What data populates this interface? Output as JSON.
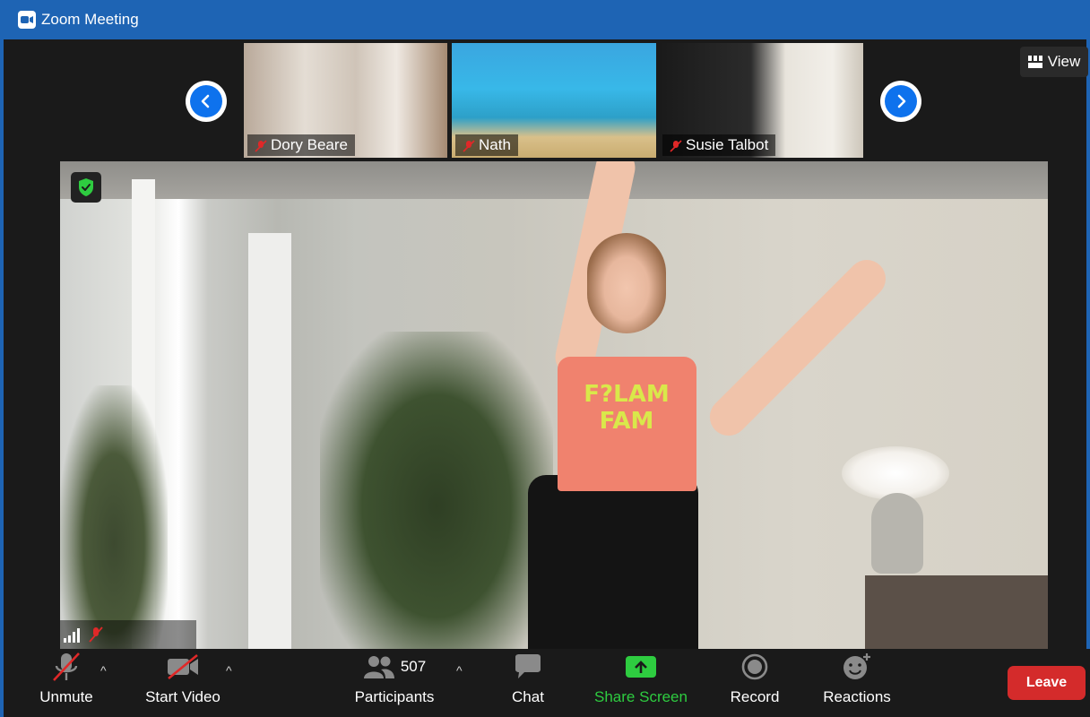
{
  "window": {
    "title": "Zoom Meeting",
    "accent_color": "#1e64b4"
  },
  "view_button": {
    "label": "View",
    "icon": "grid-icon"
  },
  "participants_strip": [
    {
      "name": "Dory Beare",
      "muted": true
    },
    {
      "name": "Nath",
      "muted": true
    },
    {
      "name": "Susie Talbot",
      "muted": true
    }
  ],
  "main_video": {
    "shirt_text_line1": "F?LAM",
    "shirt_text_line2": "FAM"
  },
  "toolbar": {
    "unmute_label": "Unmute",
    "start_video_label": "Start Video",
    "participants_label": "Participants",
    "participants_count": "507",
    "chat_label": "Chat",
    "share_screen_label": "Share Screen",
    "record_label": "Record",
    "reactions_label": "Reactions",
    "leave_label": "Leave",
    "share_color": "#2ecc40",
    "leave_color": "#d42b2b"
  }
}
